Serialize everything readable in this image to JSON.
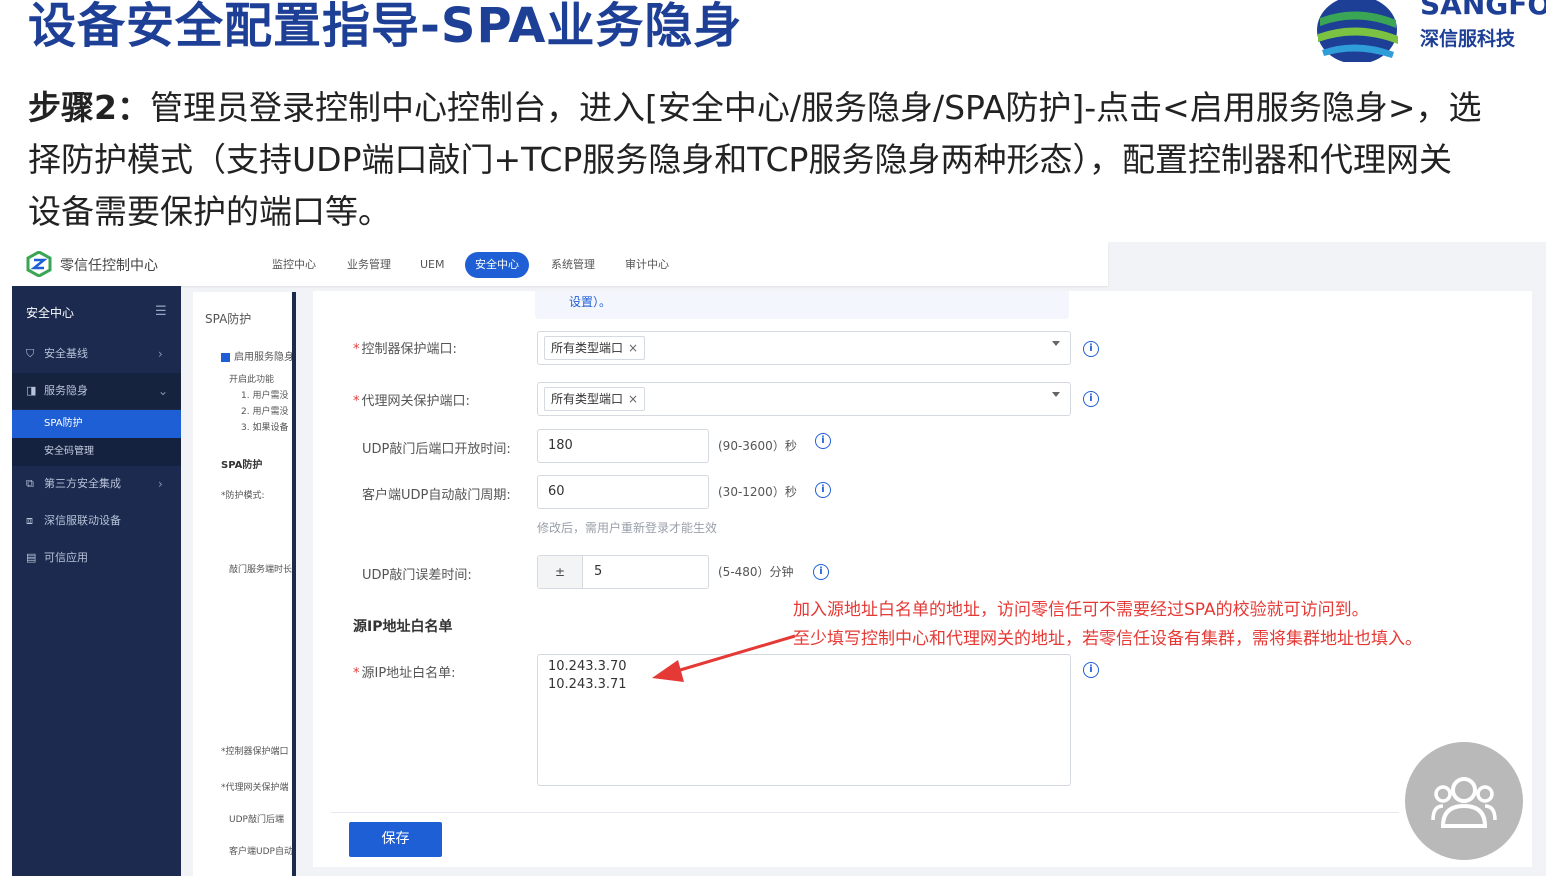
{
  "slide": {
    "title": "设备安全配置指导-SPA业务隐身",
    "logo_brand": "SANGFOR",
    "logo_brand_visible": "SANGFO",
    "logo_cn": "深信服科技",
    "step_label": "步骤2：",
    "step_line1": "管理员登录控制中心控制台，进入[安全中心/服务隐身/SPA防护]-点击<启用服务隐身>，选",
    "step_line2": "择防护模式（支持UDP端口敲门+TCP服务隐身和TCP服务隐身两种形态），配置控制器和代理网关",
    "step_line3": "设备需要保护的端口等。"
  },
  "app": {
    "name": "零信任控制中心",
    "nav": [
      "监控中心",
      "业务管理",
      "UEM",
      "安全中心",
      "系统管理",
      "审计中心"
    ],
    "active_nav": "安全中心"
  },
  "sidebar": {
    "header": "安全中心",
    "items": [
      {
        "label": "安全基线",
        "icon": "shield-icon"
      },
      {
        "label": "服务隐身",
        "icon": "hide-icon"
      },
      {
        "label": "第三方安全集成",
        "icon": "plug-icon"
      },
      {
        "label": "深信服联动设备",
        "icon": "link-icon"
      },
      {
        "label": "可信应用",
        "icon": "app-icon"
      }
    ],
    "subitems": [
      {
        "label": "SPA防护",
        "active": true
      },
      {
        "label": "安全码管理",
        "active": false
      }
    ]
  },
  "midpanel": {
    "title": "SPA防护",
    "enable_label": "启用服务隐身",
    "notice_lines": [
      "开启此功能",
      "1. 用户需没",
      "2. 用户需没",
      "3. 如果设备"
    ],
    "section": "SPA防护",
    "mode_label": "*防护模式:",
    "knock_label": "敲门服务端时长",
    "port1_label": "*控制器保护端口",
    "port2_label": "*代理网关保护端",
    "udp_label": "UDP敲门后端",
    "client_label": "客户端UDP自动"
  },
  "form": {
    "notice_tail": "设置）。",
    "controller_port": {
      "label": "控制器保护端口:",
      "tag": "所有类型端口"
    },
    "gateway_port": {
      "label": "代理网关保护端口:",
      "tag": "所有类型端口"
    },
    "udp_open_time": {
      "label": "UDP敲门后端口开放时间:",
      "value": "180",
      "unit": "(90-3600）秒"
    },
    "client_period": {
      "label": "客户端UDP自动敲门周期:",
      "value": "60",
      "unit": "(30-1200）秒",
      "hint": "修改后，需用户重新登录才能生效"
    },
    "udp_error_time": {
      "label": "UDP敲门误差时间:",
      "stepper": "±",
      "value": "5",
      "unit": "(5-480）分钟"
    },
    "whitelist_section": "源IP地址白名单",
    "whitelist": {
      "label": "源IP地址白名单:",
      "entries": [
        "10.243.3.70",
        "10.243.3.71"
      ]
    },
    "save_label": "保存"
  },
  "annotation": {
    "line1": "加入源地址白名单的地址，访问零信任可不需要经过SPA的校验就可访问到。",
    "line2": "至少填写控制中心和代理网关的地址，若零信任设备有集群，需将集群地址也填入。",
    "color": "#e53935"
  },
  "colors": {
    "title_blue": "#1d3f96",
    "accent": "#1f5fd6",
    "sidebar_bg": "#1b2a4e"
  }
}
